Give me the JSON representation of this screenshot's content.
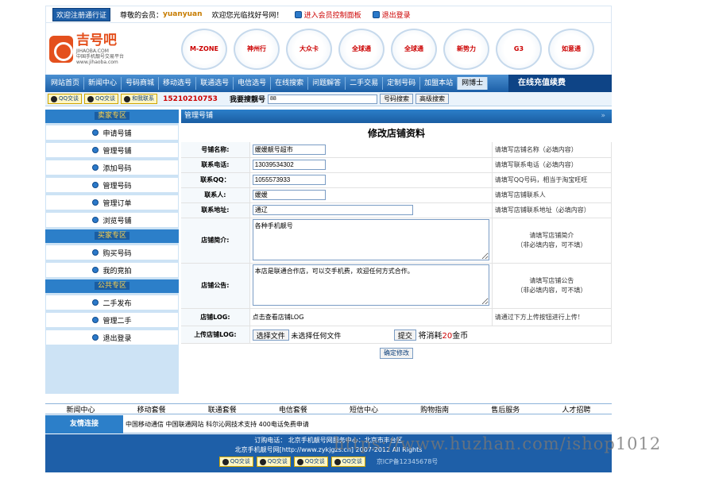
{
  "topbar": {
    "register": "欢迎注册通行证",
    "greeting_prefix": "尊敬的会员：",
    "username": "yuanyuan",
    "welcome": "欢迎您光临找好号网！",
    "control_panel": "进入会员控制面板",
    "logout": "退出登录"
  },
  "logo": {
    "name": "吉号吧",
    "domain": "JIHAOBA.COM",
    "slogan": "中国手机靓号交易平台",
    "url": "www.jihaoba.com"
  },
  "brands": [
    "M-ZONE",
    "神州行",
    "大众卡",
    "全球通",
    "全球通",
    "新势力",
    "G3",
    "如意通"
  ],
  "nav": {
    "items": [
      "网站首页",
      "新闻中心",
      "号码商城",
      "移动选号",
      "联通选号",
      "电信选号",
      "在线搜索",
      "问题解答",
      "二手交易",
      "定制号码",
      "加盟本站",
      "网博士"
    ],
    "recharge": "在线充值续费"
  },
  "searchbar": {
    "qq1": "QQ交谈",
    "qq2": "QQ交谈",
    "contact": "和我联系",
    "phone": "15210210753",
    "search_label": "我要搜靓号",
    "search_value": "88",
    "btn_search": "号码搜索",
    "btn_advanced": "高级搜索"
  },
  "sidebar": {
    "seller_title": "卖家专区",
    "seller_items": [
      "申请号铺",
      "管理号铺",
      "添加号码",
      "管理号码",
      "管理订单",
      "浏览号铺"
    ],
    "buyer_title": "买家专区",
    "buyer_items": [
      "购买号码",
      "我的竞拍"
    ],
    "public_title": "公共专区",
    "public_items": [
      "二手发布",
      "管理二手",
      "退出登录"
    ]
  },
  "main": {
    "panel_title": "管理号铺",
    "close": "»",
    "form_title": "修改店铺资料",
    "rows": [
      {
        "label": "号铺名称:",
        "value": "媛媛靓号超市",
        "hint": "请填写店铺名称（必填内容）"
      },
      {
        "label": "联系电话:",
        "value": "13039534302",
        "hint": "请填写联系电话（必填内容）"
      },
      {
        "label": "联系QQ：",
        "value": "1055573933",
        "hint": "请填写QQ号码，相当于淘宝旺旺"
      },
      {
        "label": "联系人:",
        "value": "媛媛",
        "hint": "请填写店铺联系人"
      },
      {
        "label": "联系地址:",
        "value": "通辽",
        "hint": "请填写店铺联系地址（必填内容）"
      }
    ],
    "intro": {
      "label": "店铺简介:",
      "value": "各种手机靓号",
      "hint1": "请填写店铺简介",
      "hint2": "（非必填内容，可不填）"
    },
    "notice": {
      "label": "店铺公告:",
      "value": "本店是联通合作店，可以交手机费，欢迎任何方式合作。",
      "hint1": "请填写店铺公告",
      "hint2": "（非必填内容，可不填）"
    },
    "logo_row": {
      "label": "店铺LOG:",
      "value": "点击查看店铺LOG",
      "hint": "请通过下方上传按钮进行上传！"
    },
    "upload_row": {
      "label": "上传店铺LOG:",
      "choose": "选择文件",
      "no_file": "未选择任何文件",
      "submit": "提交",
      "cost_prefix": "将消耗",
      "cost_num": "20",
      "cost_suffix": "金币"
    },
    "confirm": "确定修改"
  },
  "footer_nav": [
    "新闻中心",
    "移动套餐",
    "联通套餐",
    "电信套餐",
    "短信中心",
    "购物指南",
    "售后服务",
    "人才招聘"
  ],
  "links": {
    "title": "友情连接",
    "value": "中国移动通信 中国联通网站 科尔沁网技术支持 400电话免费申请"
  },
  "footer": {
    "line1": "订购电话：   北京手机靓号网服务中心：北京市丰台区",
    "line2": "北京手机靓号网[http://www.zykjgzs.cn]   2007-2012 All Rights",
    "qq": [
      "QQ交谈",
      "QQ交谈",
      "QQ交谈",
      "QQ交谈"
    ],
    "icp": "京ICP备12345678号"
  },
  "watermark": "https://www.huzhan.com/ishop1012"
}
